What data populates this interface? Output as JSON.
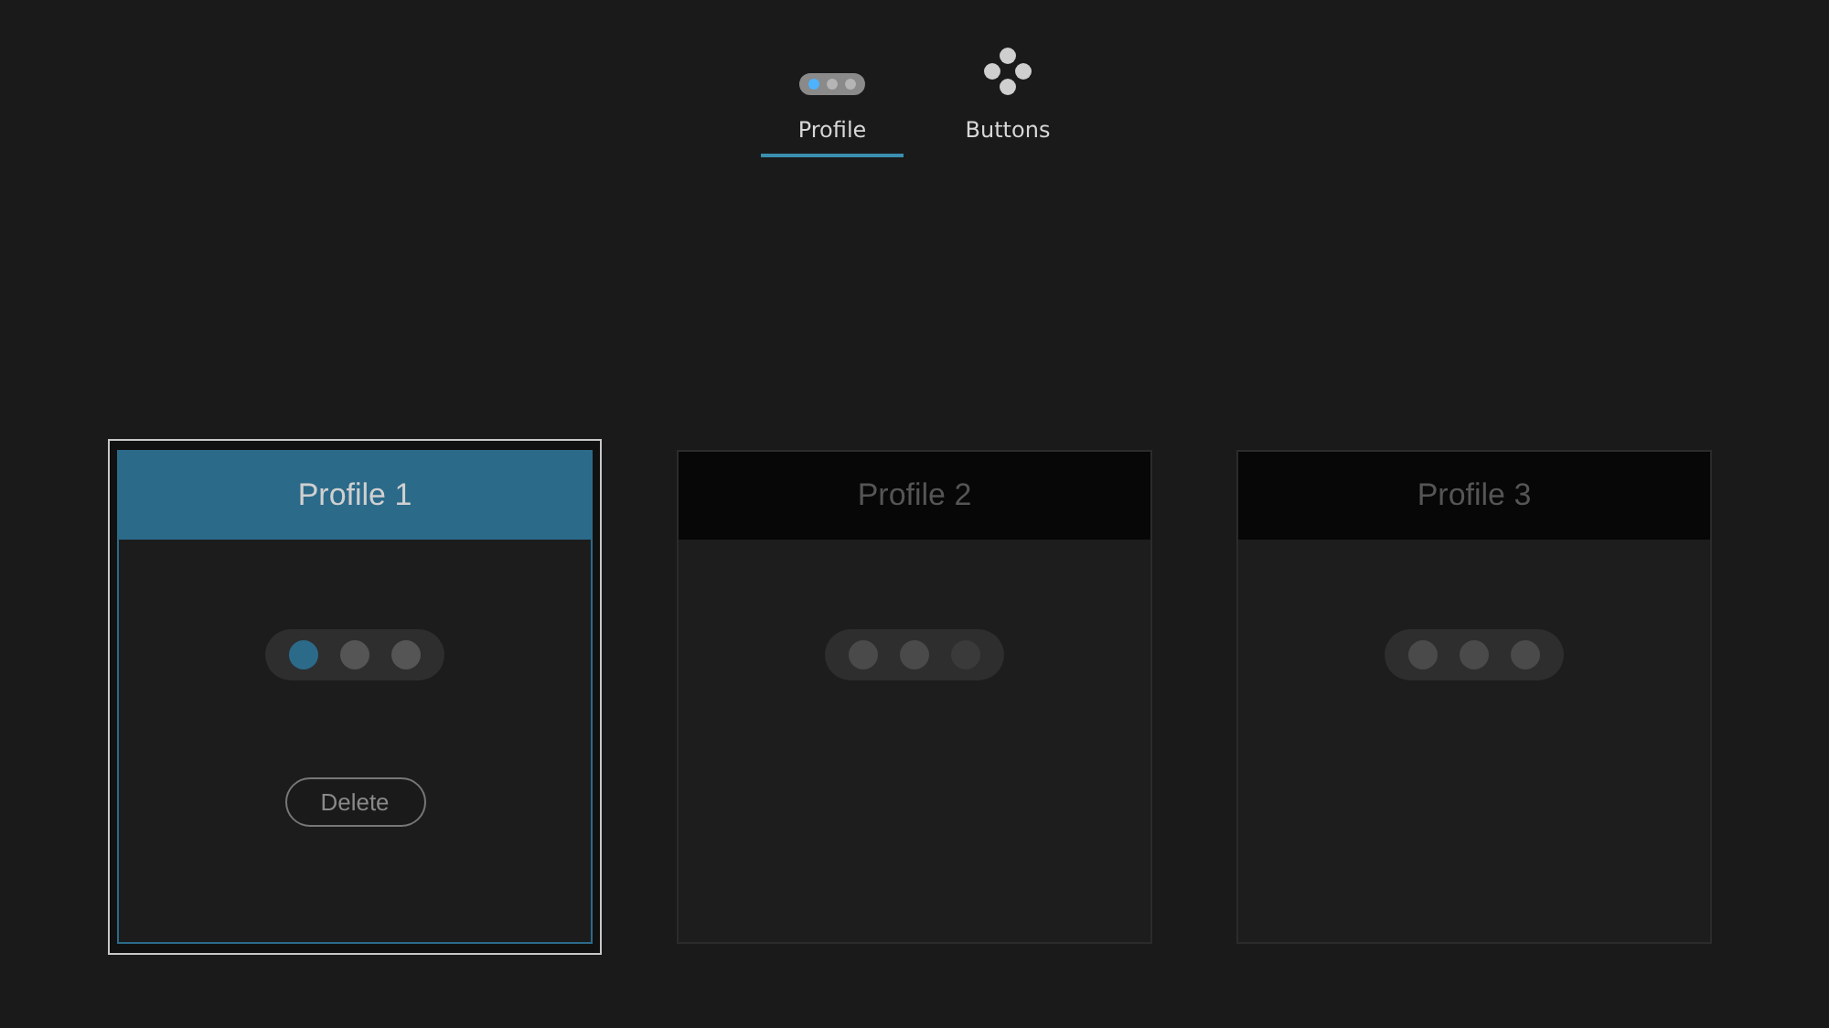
{
  "tabs": [
    {
      "label": "Profile",
      "kind": "profile",
      "selected": true
    },
    {
      "label": "Buttons",
      "kind": "buttons",
      "selected": false
    }
  ],
  "profiles": [
    {
      "title": "Profile 1",
      "selected": true,
      "dots": [
        {
          "kind": "active"
        },
        {
          "kind": "filled"
        },
        {
          "kind": "filled"
        }
      ],
      "delete_label": "Delete"
    },
    {
      "title": "Profile 2",
      "selected": false,
      "dots": [
        {
          "kind": "filled"
        },
        {
          "kind": "filled"
        },
        {
          "kind": "dim"
        }
      ]
    },
    {
      "title": "Profile 3",
      "selected": false,
      "dots": [
        {
          "kind": "filled"
        },
        {
          "kind": "filled"
        },
        {
          "kind": "filled"
        }
      ]
    }
  ]
}
